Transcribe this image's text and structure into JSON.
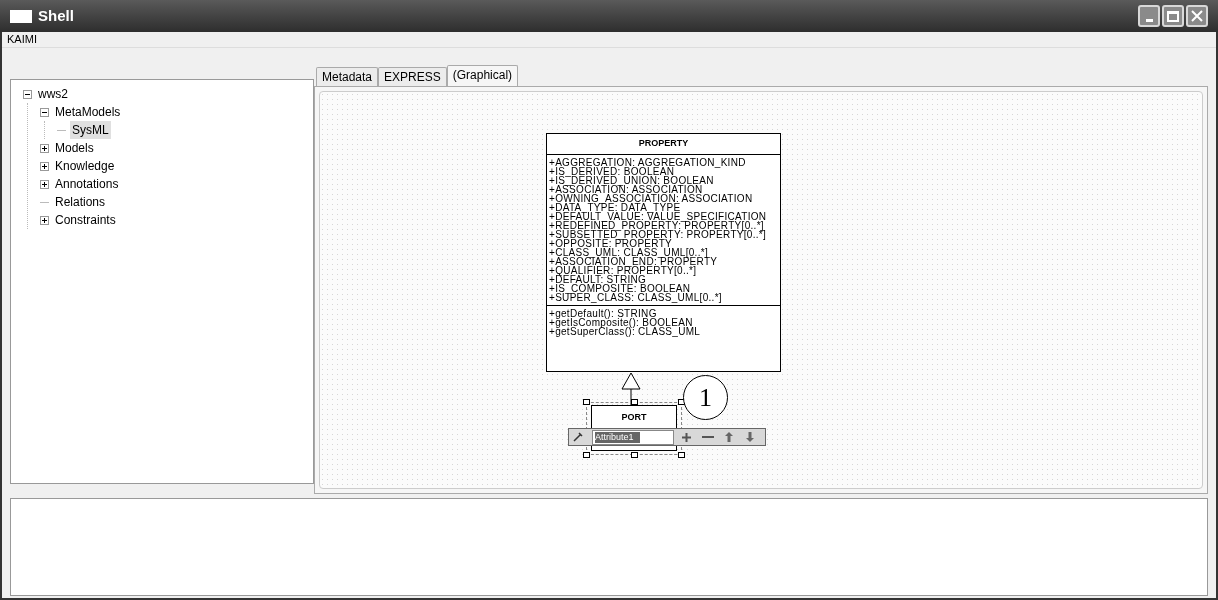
{
  "window": {
    "title": "Shell"
  },
  "menu": [
    "KAIMI"
  ],
  "tree": [
    {
      "label": "wws2",
      "kind": "node",
      "expanded": true,
      "selected": false,
      "children": [
        {
          "label": "MetaModels",
          "kind": "node",
          "expanded": true,
          "selected": false,
          "children": [
            {
              "label": "SysML",
              "kind": "leaf",
              "selected": true
            }
          ]
        },
        {
          "label": "Models",
          "kind": "node",
          "expanded": false,
          "selected": false
        },
        {
          "label": "Knowledge",
          "kind": "node",
          "expanded": false,
          "selected": false
        },
        {
          "label": "Annotations",
          "kind": "node",
          "expanded": false,
          "selected": false
        },
        {
          "label": "Relations",
          "kind": "leaf",
          "selected": false
        },
        {
          "label": "Constraints",
          "kind": "node",
          "expanded": false,
          "selected": false
        }
      ]
    }
  ],
  "tabs": [
    {
      "label": "Metadata",
      "selected": false
    },
    {
      "label": "EXPRESS",
      "selected": false
    },
    {
      "label": "(Graphical)",
      "selected": true
    }
  ],
  "diagram": {
    "class": {
      "name": "PROPERTY",
      "attributes": [
        "+AGGREGATION: AGGREGATION_KIND",
        "+IS_DERIVED: BOOLEAN",
        "+IS_DERIVED_UNION: BOOLEAN",
        "+ASSOCIATION: ASSOCIATION",
        "+OWNING_ASSOCIATION: ASSOCIATION",
        "+DATA_TYPE: DATA_TYPE",
        "+DEFAULT_VALUE: VALUE_SPECIFICATION",
        "+REDEFINED_PROPERTY: PROPERTY[0..*]",
        "+SUBSETTED_PROPERTY: PROPERTY[0..*]",
        "+OPPOSITE: PROPERTY",
        "+CLASS_UML: CLASS_UML[0..*]",
        "+ASSOCIATION_END: PROPERTY",
        "+QUALIFIER: PROPERTY[0..*]",
        "+DEFAULT: STRING",
        "+IS_COMPOSITE: BOOLEAN",
        "+SUPER_CLASS: CLASS_UML[0..*]"
      ],
      "operations": [
        "+getDefault(): STRING",
        "+getIsComposite(): BOOLEAN",
        "+getSuperClass(): CLASS_UML"
      ]
    },
    "subclass": {
      "name": "PORT",
      "editing_value": "Attribute1",
      "selected": true
    },
    "callout": "1"
  }
}
